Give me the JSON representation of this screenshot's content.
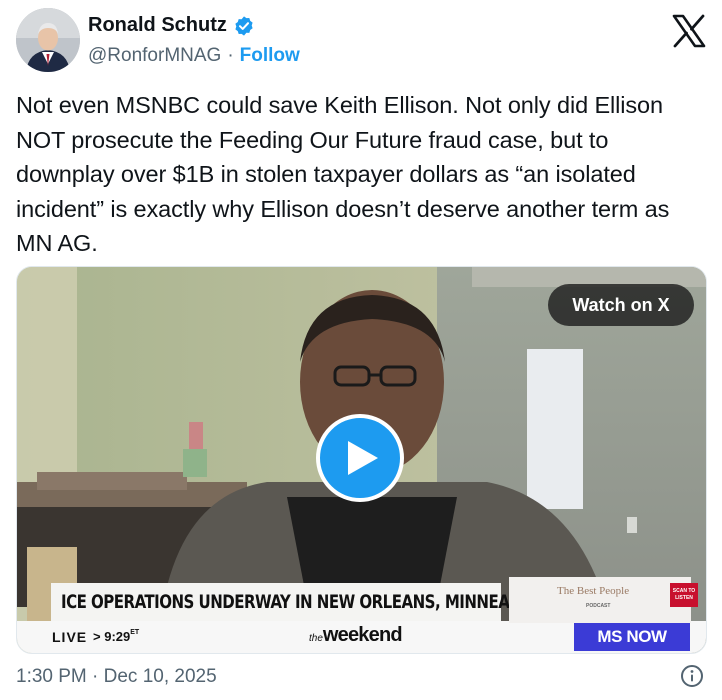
{
  "author": {
    "name": "Ronald Schutz",
    "handle": "@RonforMNAG",
    "separator": "·",
    "follow_label": "Follow",
    "verified_icon": "verified-badge-icon"
  },
  "platform_logo": "x-logo-icon",
  "tweet": {
    "text": "Not even MSNBC could save Keith Ellison. Not only did Ellison NOT prosecute the Feeding Our Future fraud case, but to downplay over $1B in stolen taxpayer dollars as “an isolated incident” is exactly why Ellison doesn’t deserve another term as MN AG.",
    "timestamp": "1:30 PM · Dec 10, 2025"
  },
  "media": {
    "watch_label": "Watch on X",
    "play_icon": "play-icon",
    "broadcast": {
      "headline": "ICE OPERATIONS UNDERWAY IN NEW ORLEANS, MINNEAPOLIS",
      "live_label": "LIVE",
      "time": "9:29",
      "time_zone": "ET",
      "show_the": "the",
      "show_name": "weekend",
      "network": "MS NOW",
      "promo_title": "The Best People",
      "promo_sub": "PODCAST",
      "scan_label": "SCAN TO LISTEN"
    }
  },
  "colors": {
    "accent": "#1d9bf0",
    "text": "#0f1419",
    "secondary": "#536471",
    "network_blue": "#3b3bd6"
  }
}
